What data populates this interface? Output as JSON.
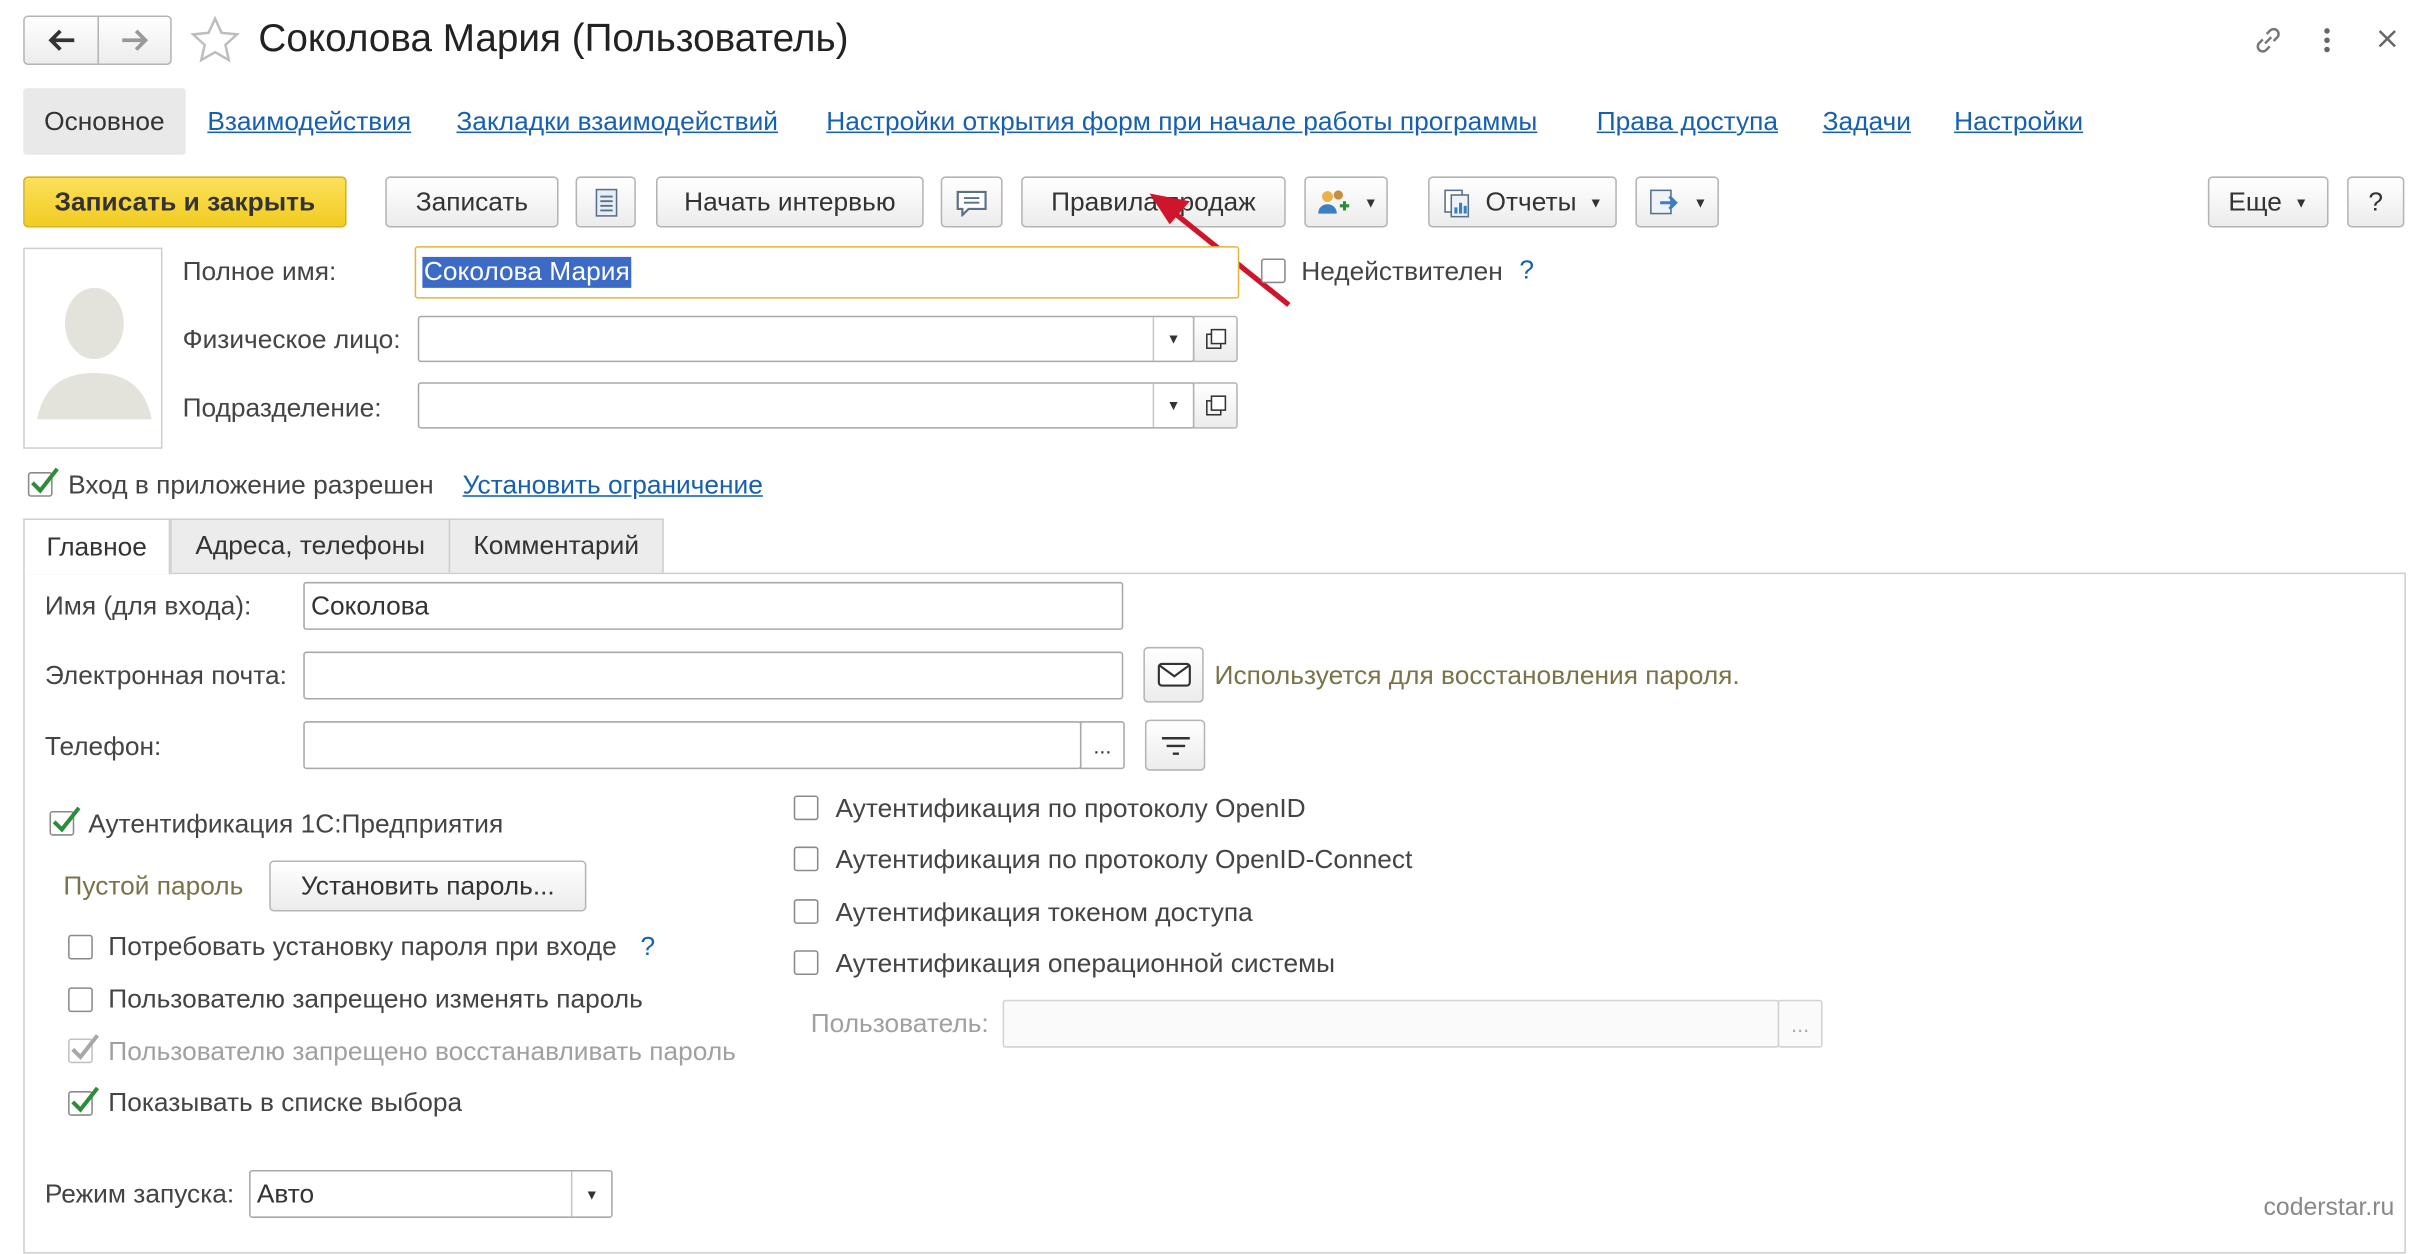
{
  "window": {
    "title": "Соколова Мария (Пользователь)"
  },
  "nav_tabs": [
    {
      "label": "Основное"
    },
    {
      "label": "Взаимодействия"
    },
    {
      "label": "Закладки взаимодействий"
    },
    {
      "label": "Настройки открытия форм при начале работы программы"
    },
    {
      "label": "Права доступа"
    },
    {
      "label": "Задачи"
    },
    {
      "label": "Настройки"
    }
  ],
  "toolbar": {
    "save_close": "Записать и закрыть",
    "save": "Записать",
    "start_interview": "Начать интервью",
    "sales_rules": "Правила продаж",
    "reports": "Отчеты",
    "more": "Еще",
    "help": "?"
  },
  "form": {
    "full_name_label": "Полное имя:",
    "full_name_value": "Соколова Мария",
    "inactive_label": "Недействителен",
    "inactive_help": "?",
    "person_label": "Физическое лицо:",
    "person_value": "",
    "department_label": "Подразделение:",
    "department_value": "",
    "login_allowed_label": "Вход в приложение разрешен",
    "set_restriction_link": "Установить ограничение"
  },
  "inner_tabs": [
    {
      "label": "Главное"
    },
    {
      "label": "Адреса, телефоны"
    },
    {
      "label": "Комментарий"
    }
  ],
  "main": {
    "login_name_label": "Имя (для входа):",
    "login_name_value": "Соколова",
    "email_label": "Электронная почта:",
    "email_value": "",
    "email_hint": "Используется для восстановления пароля.",
    "phone_label": "Телефон:",
    "phone_value": "",
    "phone_ellipsis": "...",
    "auth_1c_label": "Аутентификация 1С:Предприятия",
    "empty_password_label": "Пустой пароль",
    "set_password_button": "Установить пароль...",
    "require_password_label": "Потребовать установку пароля при входе",
    "require_password_help": "?",
    "deny_change_label": "Пользователю запрещено изменять пароль",
    "deny_restore_label": "Пользователю запрещено восстанавливать пароль",
    "show_in_list_label": "Показывать в списке выбора",
    "auth_openid_label": "Аутентификация по протоколу OpenID",
    "auth_openid_connect_label": "Аутентификация по протоколу OpenID-Connect",
    "auth_token_label": "Аутентификация токеном доступа",
    "auth_os_label": "Аутентификация операционной системы",
    "os_user_label": "Пользователь:",
    "os_user_value": "",
    "os_user_ellipsis": "...",
    "launch_mode_label": "Режим запуска:",
    "launch_mode_value": "Авто"
  },
  "checks": {
    "inactive": false,
    "login_allowed": true,
    "auth_1c": true,
    "require_password": false,
    "deny_change": false,
    "deny_restore": true,
    "show_in_list": true,
    "auth_openid": false,
    "auth_openid_connect": false,
    "auth_token": false,
    "auth_os": false
  },
  "watermark": "coderstar.ru",
  "colors": {
    "accent_yellow": "#f7d43a",
    "link_blue": "#1660b0",
    "check_green": "#2e8b3a",
    "hint_olive": "#7a7248",
    "annotation_arrow": "#d0142b"
  },
  "icons": [
    "back-arrow-icon",
    "forward-arrow-icon",
    "star-icon",
    "link-icon",
    "more-vert-icon",
    "close-icon",
    "list-icon",
    "comment-icon",
    "users-add-icon",
    "reports-icon",
    "export-icon",
    "avatar-icon",
    "open-icon",
    "envelope-icon",
    "filter-icon"
  ]
}
